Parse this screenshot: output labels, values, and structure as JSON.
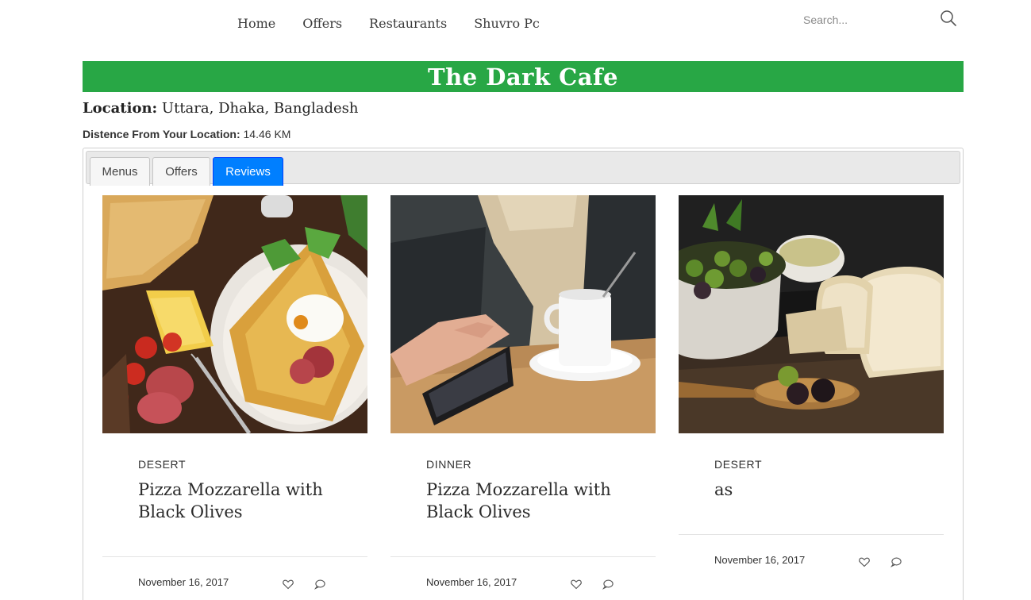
{
  "nav": {
    "links": [
      "Home",
      "Offers",
      "Restaurants",
      "Shuvro Pc"
    ],
    "search_placeholder": "Search..."
  },
  "restaurant": {
    "name": "The Dark Cafe",
    "location_label": "Location:",
    "location_value": "Uttara, Dhaka, Bangladesh",
    "distance_label": "Distence From Your Location:",
    "distance_value": "14.46 KM"
  },
  "tabs": [
    {
      "label": "Menus",
      "active": false
    },
    {
      "label": "Offers",
      "active": false
    },
    {
      "label": "Reviews",
      "active": true
    }
  ],
  "cards": [
    {
      "category": "DESERT",
      "title": "Pizza Mozzarella with Black Olives",
      "date": "November 16, 2017",
      "image": "crepe-breakfast-photo"
    },
    {
      "category": "DINNER",
      "title": "Pizza Mozzarella with Black Olives",
      "date": "November 16, 2017",
      "image": "coffee-cup-phone-photo"
    },
    {
      "category": "DESERT",
      "title": "as",
      "date": "November 16, 2017",
      "image": "olives-bread-photo"
    }
  ],
  "colors": {
    "title_bar": "#28a745",
    "active_tab": "#007fff"
  }
}
